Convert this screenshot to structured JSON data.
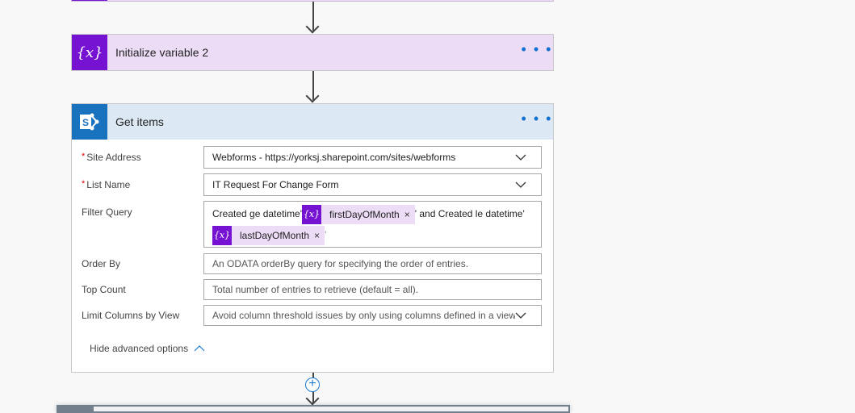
{
  "steps": {
    "init_var": {
      "title": "Initialize variable 2",
      "icon": "variable-icon",
      "icon_glyph": "{x}",
      "color": "#7612d1"
    },
    "get_items": {
      "title": "Get items",
      "icon": "sharepoint-icon",
      "color": "#1872be",
      "fields": {
        "site_address": {
          "label": "Site Address",
          "required": "*",
          "value": "Webforms - https://yorksj.sharepoint.com/sites/webforms"
        },
        "list_name": {
          "label": "List Name",
          "required": "*",
          "value": "IT Request For Change Form"
        },
        "filter_query": {
          "label": "Filter Query",
          "text1": "Created ge datetime'",
          "token1": "firstDayOfMonth",
          "text2": "' and Created le datetime'",
          "token2": "lastDayOfMonth",
          "text3": "'",
          "token_glyph": "{x}",
          "remove_glyph": "×"
        },
        "order_by": {
          "label": "Order By",
          "placeholder": "An ODATA orderBy query for specifying the order of entries."
        },
        "top_count": {
          "label": "Top Count",
          "placeholder": "Total number of entries to retrieve (default = all)."
        },
        "limit_columns": {
          "label": "Limit Columns by View",
          "placeholder": "Avoid column threshold issues by only using columns defined in a view"
        }
      },
      "hide_advanced": "Hide advanced options"
    }
  },
  "more_glyph": "• • •",
  "add_step_glyph": "+"
}
